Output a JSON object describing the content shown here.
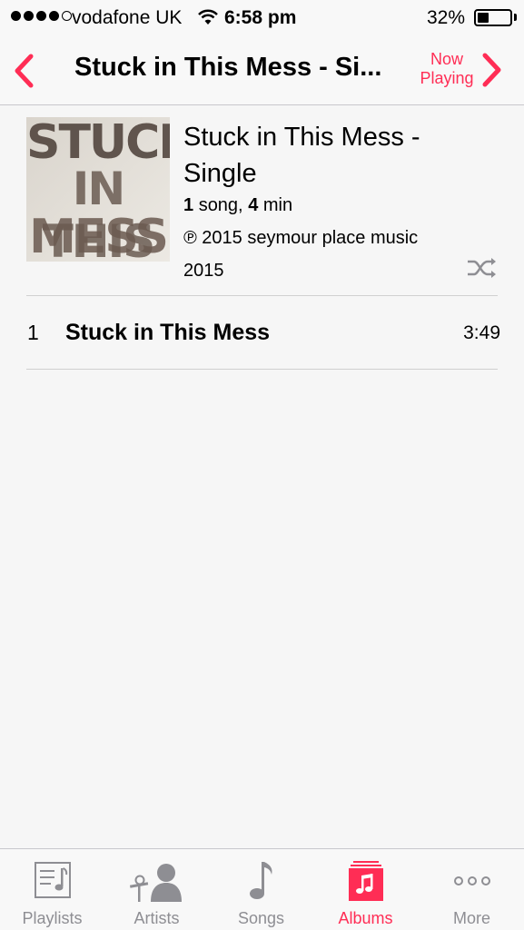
{
  "status_bar": {
    "carrier": "vodafone UK",
    "time": "6:58 pm",
    "battery_percent": "32%",
    "signal_bars": 4,
    "signal_total": 5,
    "icons": [
      "signal-dots-icon",
      "wifi-icon",
      "battery-icon"
    ]
  },
  "nav": {
    "title": "Stuck in This Mess - Si...",
    "now_playing_line1": "Now",
    "now_playing_line2": "Playing",
    "back_icon": "chevron-left-icon",
    "forward_icon": "chevron-right-icon"
  },
  "album": {
    "art_text_line1": "STUCK",
    "art_text_line2": "IN THIS",
    "art_text_line3": "MESS",
    "title_line1": "Stuck in This Mess -",
    "title_line2": "Single",
    "song_count": "1",
    "song_word": "song,",
    "duration_minutes": "4",
    "duration_word": "min",
    "copyright": "℗ 2015 seymour place music",
    "year": "2015",
    "shuffle_icon": "shuffle-icon"
  },
  "tracks": [
    {
      "number": "1",
      "title": "Stuck in This Mess",
      "duration": "3:49"
    }
  ],
  "tabs": [
    {
      "label": "Playlists",
      "icon": "playlists-icon",
      "active": false
    },
    {
      "label": "Artists",
      "icon": "artists-icon",
      "active": false
    },
    {
      "label": "Songs",
      "icon": "songs-icon",
      "active": false
    },
    {
      "label": "Albums",
      "icon": "albums-icon",
      "active": true
    },
    {
      "label": "More",
      "icon": "more-icon",
      "active": false
    }
  ],
  "colors": {
    "accent": "#ff2d55",
    "inactive_tab": "#8e8e93",
    "background": "#f6f6f6"
  }
}
